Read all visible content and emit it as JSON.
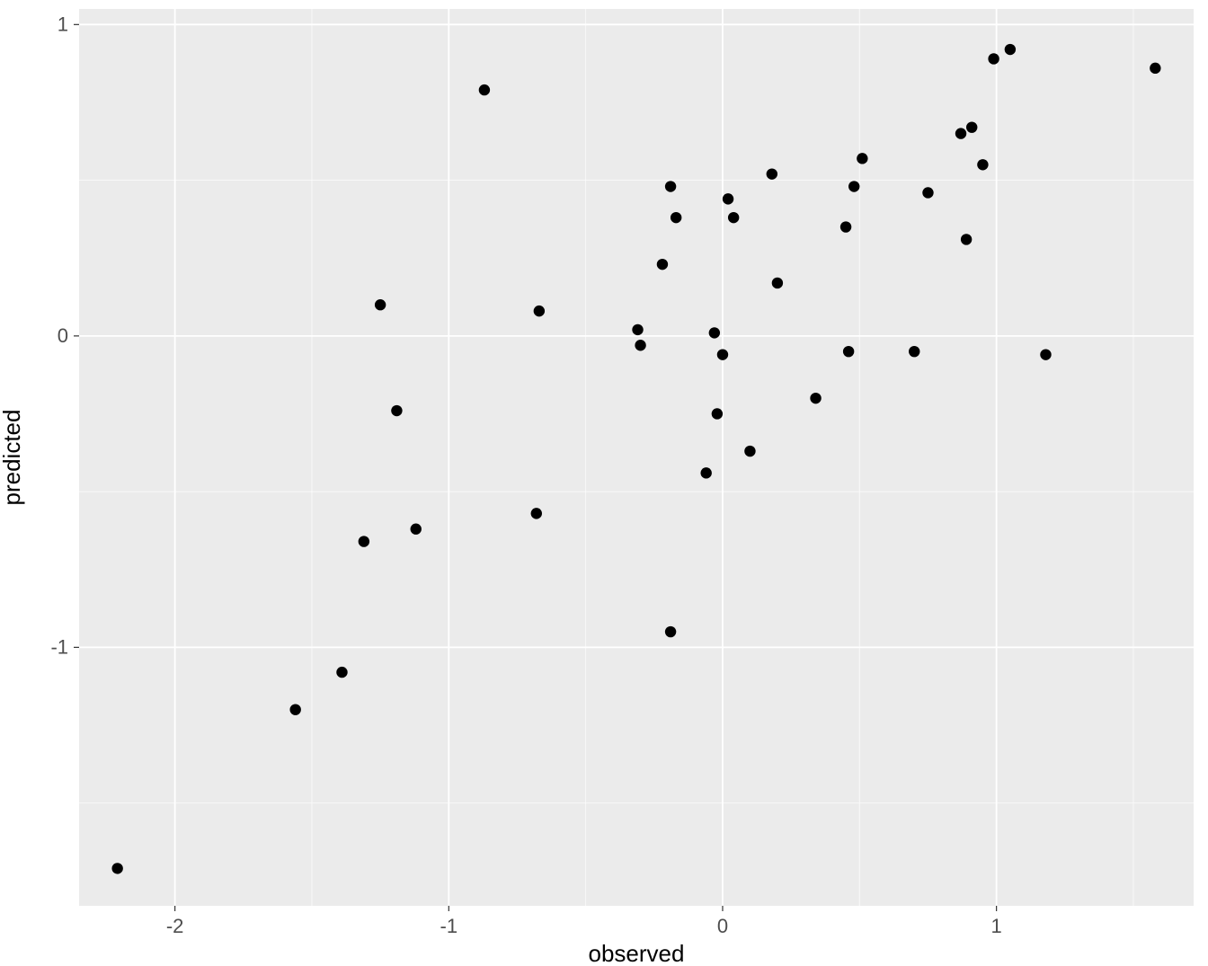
{
  "chart_data": {
    "type": "scatter",
    "title": "",
    "xlabel": "observed",
    "ylabel": "predicted",
    "xlim": [
      -2.35,
      1.72
    ],
    "ylim": [
      -1.83,
      1.05
    ],
    "x_ticks": [
      -2,
      -1,
      0,
      1
    ],
    "y_ticks": [
      -1,
      0,
      1
    ],
    "series": [
      {
        "name": "points",
        "x": [
          -2.21,
          -1.56,
          -1.39,
          -1.31,
          -1.25,
          -1.19,
          -1.12,
          -0.87,
          -0.68,
          -0.67,
          -0.31,
          -0.3,
          -0.22,
          -0.19,
          -0.19,
          -0.17,
          -0.06,
          -0.03,
          -0.02,
          0.0,
          0.02,
          0.04,
          0.1,
          0.18,
          0.2,
          0.34,
          0.45,
          0.46,
          0.48,
          0.51,
          0.7,
          0.75,
          0.87,
          0.89,
          0.91,
          0.95,
          0.99,
          1.05,
          1.18,
          1.58
        ],
        "y": [
          -1.71,
          -1.2,
          -1.08,
          -0.66,
          0.1,
          -0.24,
          -0.62,
          0.79,
          -0.57,
          0.08,
          0.02,
          -0.03,
          0.23,
          -0.95,
          0.48,
          0.38,
          -0.44,
          0.01,
          -0.25,
          -0.06,
          0.44,
          0.38,
          -0.37,
          0.52,
          0.17,
          -0.2,
          0.35,
          -0.05,
          0.48,
          0.57,
          -0.05,
          0.46,
          0.65,
          0.31,
          0.67,
          0.55,
          0.89,
          0.92,
          -0.06,
          0.86
        ]
      }
    ]
  },
  "axis": {
    "xlabel": "observed",
    "ylabel": "predicted",
    "xtick_neg2": "-2",
    "xtick_neg1": "-1",
    "xtick_0": "0",
    "xtick_1": "1",
    "ytick_neg1": "-1",
    "ytick_0": "0",
    "ytick_1": "1"
  }
}
